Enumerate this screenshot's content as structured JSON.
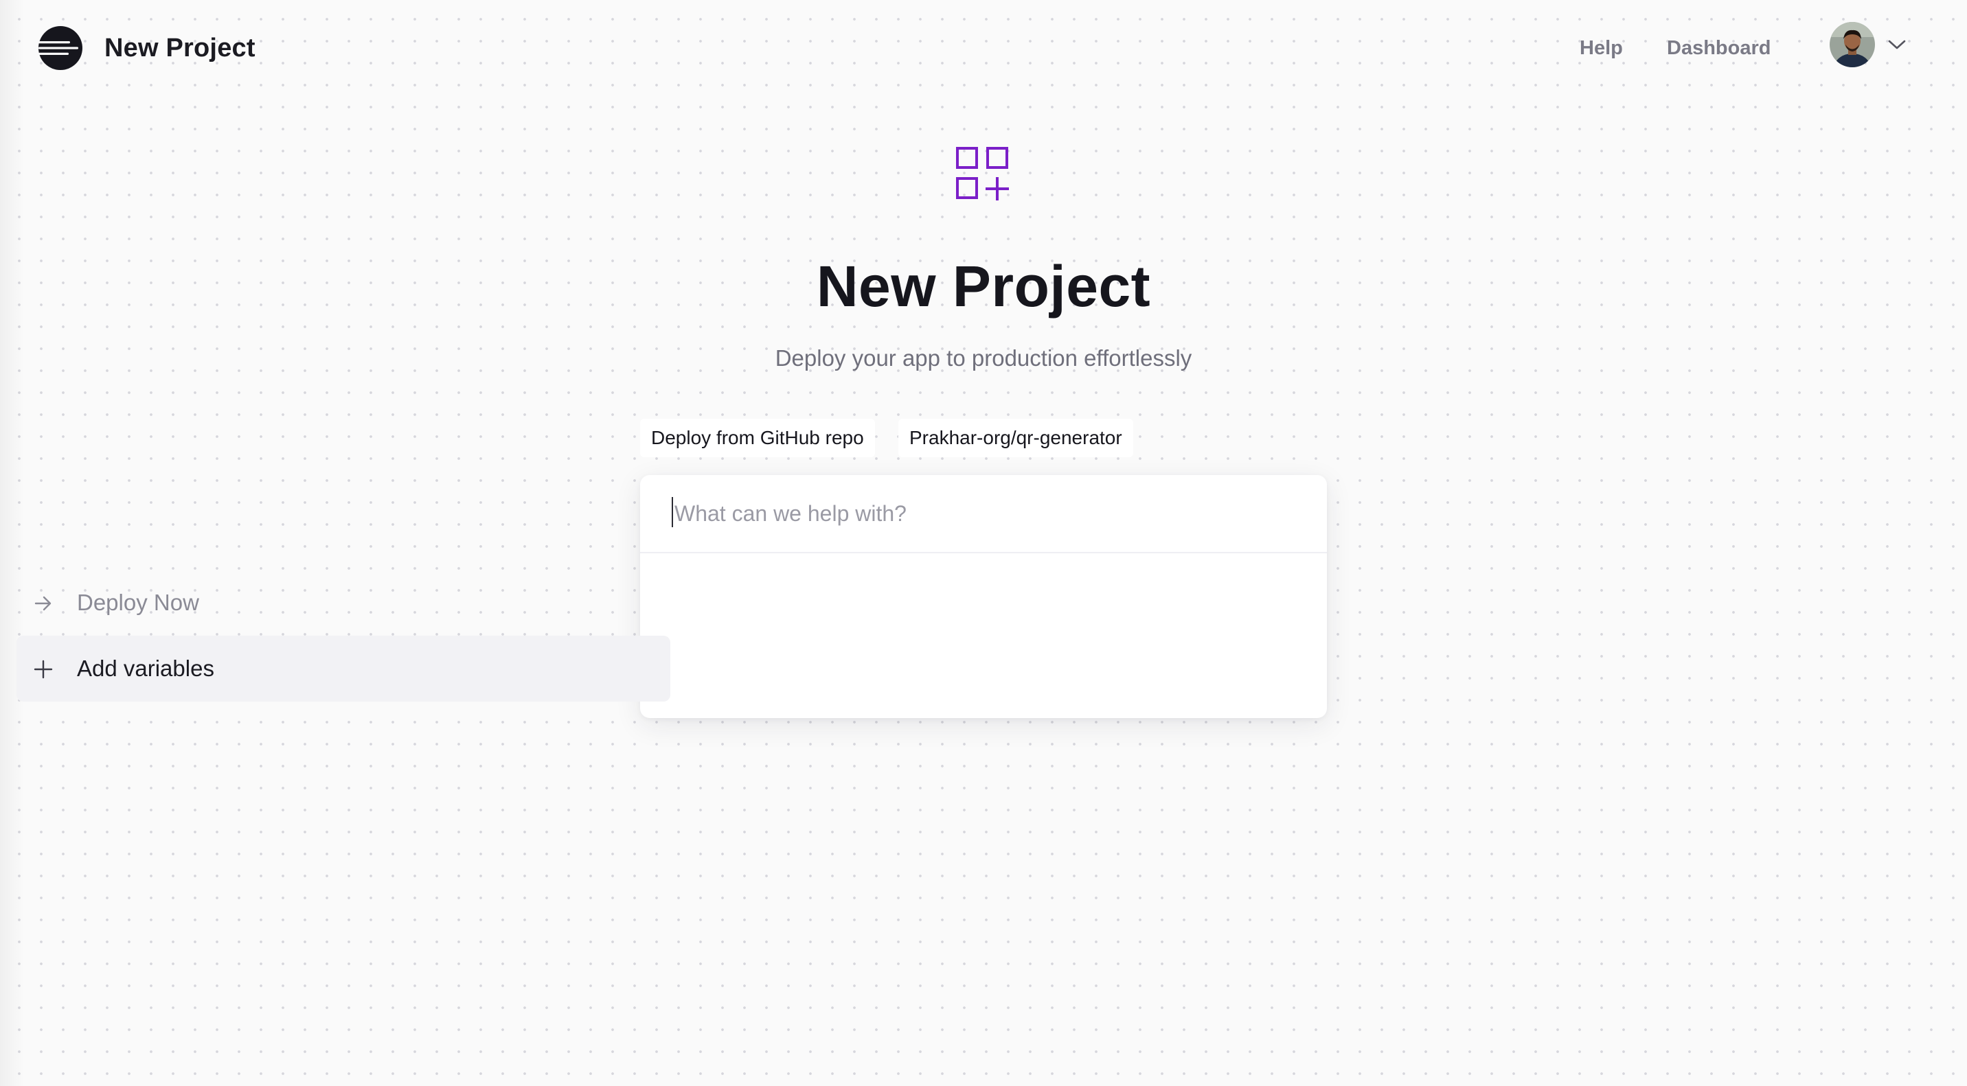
{
  "header": {
    "app_title": "New Project",
    "nav": {
      "help": "Help",
      "dashboard": "Dashboard"
    },
    "logo_icon": "railway-logo-icon",
    "avatar_icon": "user-avatar",
    "menu_icon": "chevron-down-icon"
  },
  "hero": {
    "icon": "apps-add-icon",
    "title": "New Project",
    "subtitle": "Deploy your app to production effortlessly"
  },
  "breadcrumb_chips": [
    "Deploy from GitHub repo",
    "Prakhar-org/qr-generator"
  ],
  "command_menu": {
    "search": {
      "value": "",
      "placeholder": "What can we help with?"
    },
    "items": [
      {
        "label": "Deploy Now",
        "icon": "arrow-right-icon",
        "state": "default"
      },
      {
        "label": "Add variables",
        "icon": "plus-icon",
        "state": "highlighted"
      }
    ]
  },
  "colors": {
    "accent_purple": "#7b1fc8",
    "background": "#fafafa",
    "text_primary": "#16161d",
    "text_muted": "#6f6f7b",
    "highlight": "#f2f2f5"
  }
}
